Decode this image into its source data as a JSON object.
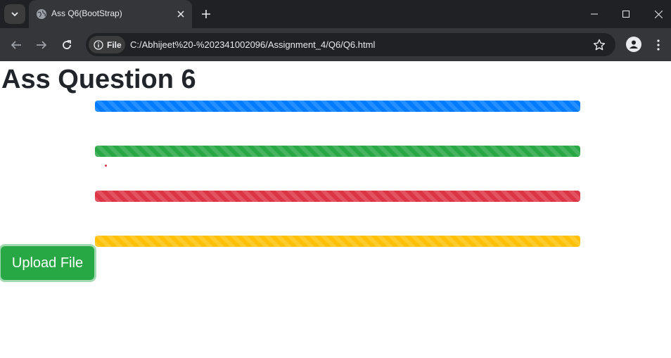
{
  "browser": {
    "tab_title": "Ass Q6(BootStrap)",
    "address_chip_label": "File",
    "url": "C:/Abhijeet%20-%202341002096/Assignment_4/Q6/Q6.html",
    "icons": [
      "tab-search-icon",
      "globe-icon",
      "close-icon",
      "plus-icon",
      "minimize-icon",
      "maximize-icon",
      "window-close-icon",
      "back-icon",
      "forward-icon",
      "reload-icon",
      "info-icon",
      "star-icon",
      "profile-icon",
      "more-icon"
    ]
  },
  "page": {
    "heading": "Ass Question 6",
    "progress_bars": [
      {
        "color": "#007bff",
        "value": 100,
        "style": "striped"
      },
      {
        "color": "#28a745",
        "value": 100,
        "style": "striped"
      },
      {
        "color": "#dc3545",
        "value": 100,
        "style": "striped"
      },
      {
        "color": "#ffc107",
        "value": 100,
        "style": "striped"
      }
    ],
    "upload_button": {
      "label": "Upload File",
      "color": "#28a745"
    }
  }
}
